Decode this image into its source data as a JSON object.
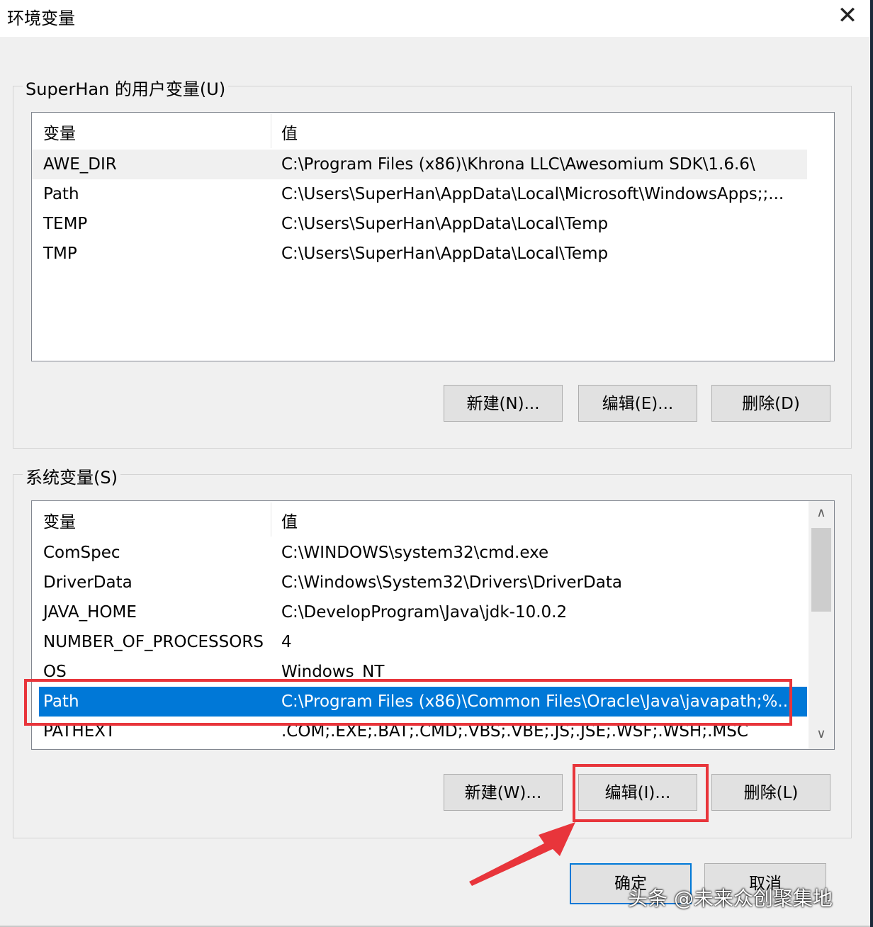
{
  "window": {
    "title": "环境变量",
    "close_symbol": "✕"
  },
  "user_vars": {
    "group_label": "SuperHan 的用户变量(U)",
    "headers": {
      "name": "变量",
      "value": "值"
    },
    "rows": [
      {
        "name": "AWE_DIR",
        "value": "C:\\Program Files (x86)\\Khrona LLC\\Awesomium SDK\\1.6.6\\"
      },
      {
        "name": "Path",
        "value": "C:\\Users\\SuperHan\\AppData\\Local\\Microsoft\\WindowsApps;;..."
      },
      {
        "name": "TEMP",
        "value": "C:\\Users\\SuperHan\\AppData\\Local\\Temp"
      },
      {
        "name": "TMP",
        "value": "C:\\Users\\SuperHan\\AppData\\Local\\Temp"
      }
    ],
    "buttons": {
      "new": "新建(N)...",
      "edit": "编辑(E)...",
      "delete": "删除(D)"
    }
  },
  "system_vars": {
    "group_label": "系统变量(S)",
    "headers": {
      "name": "变量",
      "value": "值"
    },
    "rows": [
      {
        "name": "ComSpec",
        "value": "C:\\WINDOWS\\system32\\cmd.exe"
      },
      {
        "name": "DriverData",
        "value": "C:\\Windows\\System32\\Drivers\\DriverData"
      },
      {
        "name": "JAVA_HOME",
        "value": "C:\\DevelopProgram\\Java\\jdk-10.0.2"
      },
      {
        "name": "NUMBER_OF_PROCESSORS",
        "value": "4"
      },
      {
        "name": "OS",
        "value": "Windows_NT"
      },
      {
        "name": "Path",
        "value": "C:\\Program Files (x86)\\Common Files\\Oracle\\Java\\javapath;%..."
      },
      {
        "name": "PATHEXT",
        "value": ".COM;.EXE;.BAT;.CMD;.VBS;.VBE;.JS;.JSE;.WSF;.WSH;.MSC"
      }
    ],
    "selected_row": "Path",
    "buttons": {
      "new": "新建(W)...",
      "edit": "编辑(I)...",
      "delete": "删除(L)"
    },
    "scroll_up": "∧",
    "scroll_down": "∨"
  },
  "footer": {
    "ok": "确定",
    "cancel": "取消"
  },
  "watermark": "头条 @未来众创聚集地",
  "colors": {
    "selection": "#0078d7",
    "annotation": "#e8353b"
  }
}
